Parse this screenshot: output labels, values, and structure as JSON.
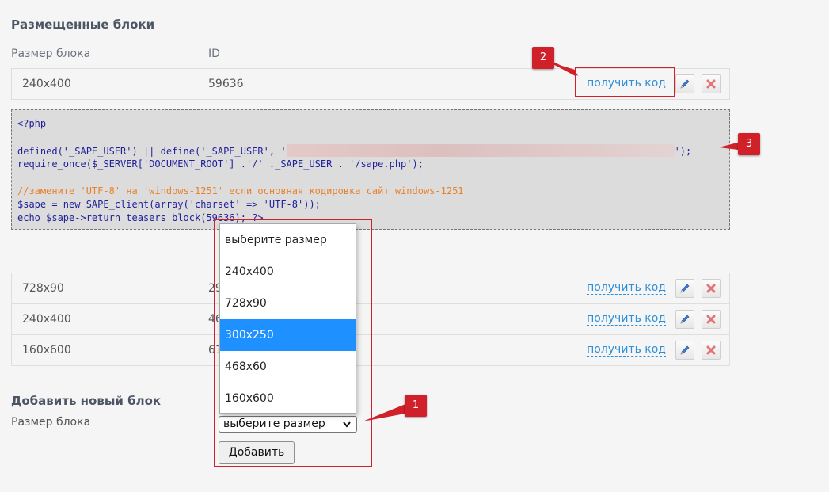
{
  "placed": {
    "title": "Размещенные блоки",
    "col_size": "Размер блока",
    "col_id": "ID",
    "get_code_label": "получить код",
    "rows": [
      {
        "size": "240x400",
        "id": "59636"
      },
      {
        "size": "728x90",
        "id": "29"
      },
      {
        "size": "240x400",
        "id": "46"
      },
      {
        "size": "160x600",
        "id": "61"
      }
    ]
  },
  "code": {
    "lines": [
      "<?php",
      "",
      "defined('_SAPE_USER') || define('_SAPE_USER', '",
      "require_once($_SERVER['DOCUMENT_ROOT'] .'/' ._SAPE_USER . '/sape.php');",
      "",
      "//замените 'UTF-8' на 'windows-1251' если основная кодировка сайт windows-1251",
      "$sape = new SAPE_client(array('charset' => 'UTF-8'));",
      "echo $sape->return_teasers_block(59636); ?>"
    ],
    "line2_tail": "');"
  },
  "add": {
    "title": "Добавить новый блок",
    "size_label": "Размер блока",
    "selected": "выберите размер",
    "options": [
      "выберите размер",
      "240x400",
      "728x90",
      "300x250",
      "468x60",
      "160x600"
    ],
    "highlighted": "300x250",
    "button": "Добавить"
  },
  "markers": [
    "1",
    "2",
    "3"
  ],
  "colors": {
    "accent": "#d0202a",
    "link": "#2f8fd8",
    "highlight": "#1e90ff"
  }
}
